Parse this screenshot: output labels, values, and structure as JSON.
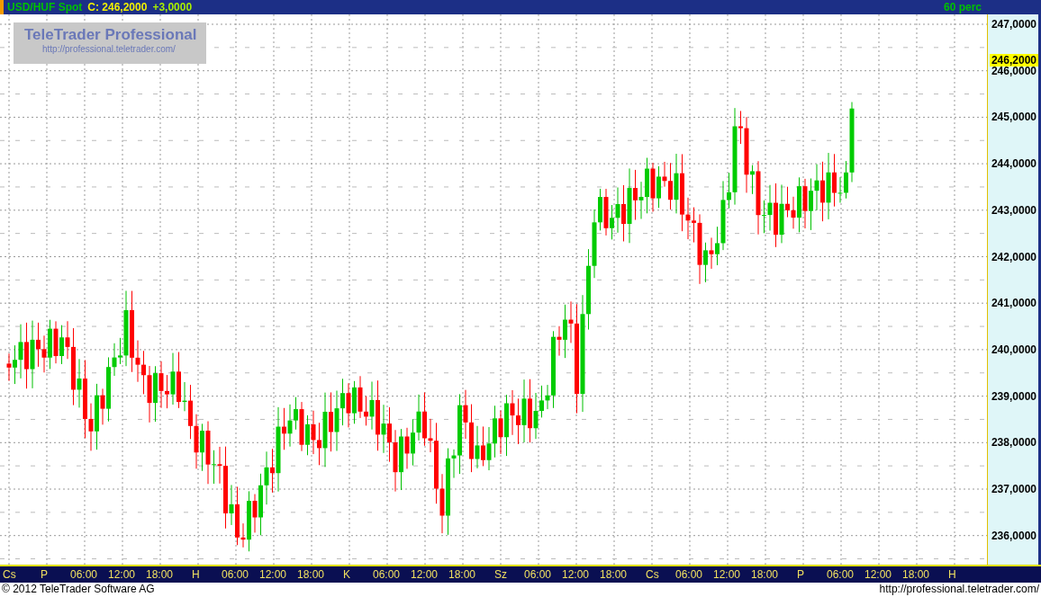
{
  "header": {
    "symbol": "USD/HUF Spot",
    "close_label": "C: 246,2000",
    "change": "+3,0000",
    "interval": "60 perc"
  },
  "watermark": {
    "title": "TeleTrader Professional",
    "url": "http://professional.teletrader.com/"
  },
  "price_axis": {
    "labels": [
      "247,0000",
      "246,0000",
      "245,0000",
      "244,0000",
      "243,0000",
      "242,0000",
      "241,0000",
      "240,0000",
      "239,0000",
      "238,0000",
      "237,0000",
      "236,0000"
    ],
    "current_price": "246,2000"
  },
  "time_axis": {
    "labels": [
      "Cs",
      "P",
      "06:00",
      "12:00",
      "18:00",
      "H",
      "06:00",
      "12:00",
      "18:00",
      "K",
      "06:00",
      "12:00",
      "18:00",
      "Sz",
      "06:00",
      "12:00",
      "18:00",
      "Cs",
      "06:00",
      "12:00",
      "18:00",
      "P",
      "06:00",
      "12:00",
      "18:00",
      "H"
    ]
  },
  "footer": {
    "copyright": "© 2012 TeleTrader Software AG",
    "url": "http://professional.teletrader.com/"
  }
}
